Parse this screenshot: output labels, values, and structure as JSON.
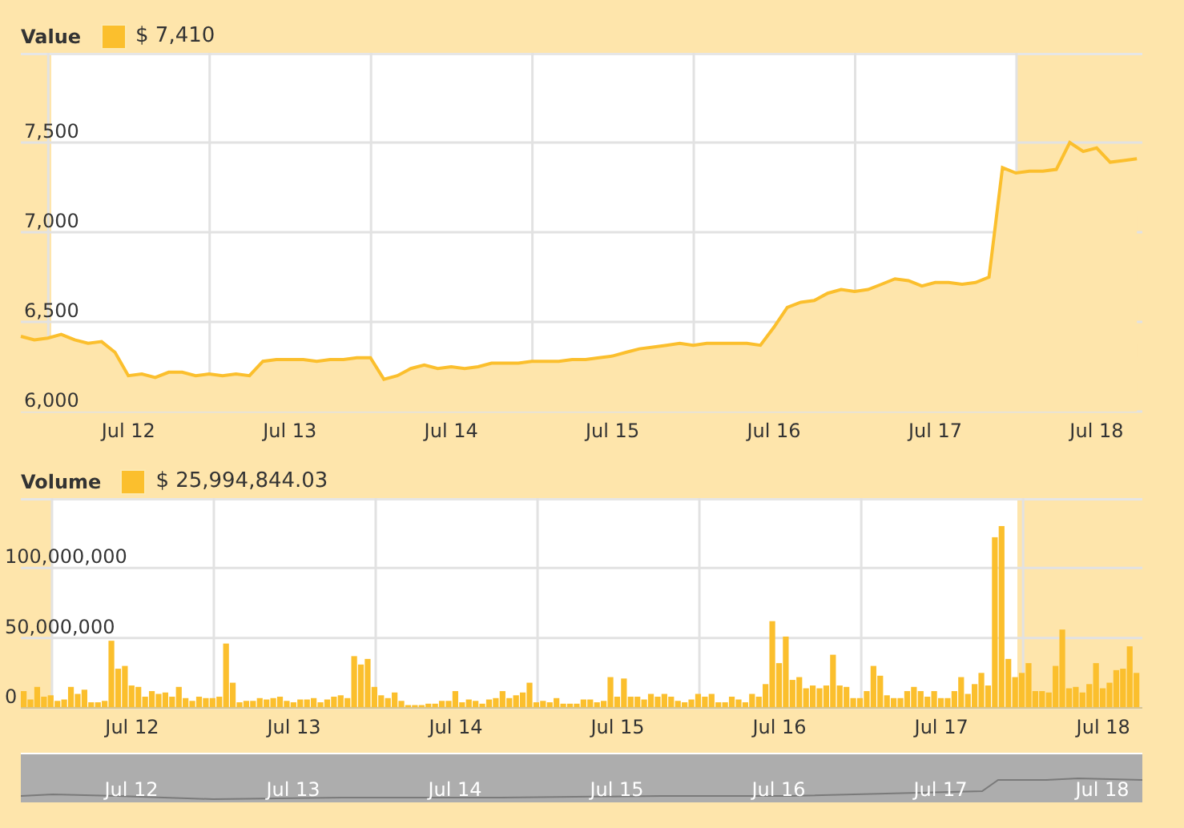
{
  "value_chart": {
    "reading": "$ 7,410",
    "chart_data": {
      "type": "area",
      "grid": true,
      "ylim": [
        6000,
        8000
      ],
      "categories": [
        null,
        null,
        null,
        null,
        null,
        null,
        null,
        null,
        "Jul 12",
        null,
        null,
        null,
        null,
        null,
        null,
        null,
        null,
        null,
        null,
        null,
        "Jul 13",
        null,
        null,
        null,
        null,
        null,
        null,
        null,
        null,
        null,
        null,
        null,
        "Jul 14",
        null,
        null,
        null,
        null,
        null,
        null,
        null,
        null,
        null,
        null,
        null,
        "Jul 15",
        null,
        null,
        null,
        null,
        null,
        null,
        null,
        null,
        null,
        null,
        null,
        "Jul 16",
        null,
        null,
        null,
        null,
        null,
        null,
        null,
        null,
        null,
        null,
        null,
        "Jul 17",
        null,
        null,
        null,
        null,
        null,
        null,
        null,
        null,
        null,
        null,
        null,
        "Jul 18",
        null,
        null,
        null
      ],
      "yticks": [
        {
          "value": 6000,
          "label": "6,000"
        },
        {
          "value": 6500,
          "label": "6,500"
        },
        {
          "value": 7000,
          "label": "7,000"
        },
        {
          "value": 7500,
          "label": "7,500"
        }
      ],
      "series": [
        {
          "name": "Value",
          "color": "#fbbf2d",
          "values": [
            6420,
            6400,
            6410,
            6430,
            6400,
            6380,
            6390,
            6330,
            6200,
            6210,
            6190,
            6220,
            6220,
            6200,
            6210,
            6200,
            6210,
            6200,
            6280,
            6290,
            6290,
            6290,
            6280,
            6290,
            6290,
            6300,
            6300,
            6180,
            6200,
            6240,
            6260,
            6240,
            6250,
            6240,
            6250,
            6270,
            6270,
            6270,
            6280,
            6280,
            6280,
            6290,
            6290,
            6300,
            6310,
            6330,
            6350,
            6360,
            6370,
            6380,
            6370,
            6380,
            6380,
            6380,
            6380,
            6370,
            6470,
            6580,
            6610,
            6620,
            6660,
            6680,
            6670,
            6680,
            6710,
            6740,
            6730,
            6700,
            6720,
            6720,
            6710,
            6720,
            6750,
            7360,
            7330,
            7340,
            7340,
            7350,
            7500,
            7450,
            7470,
            7390,
            7400,
            7410
          ]
        }
      ]
    }
  },
  "volume_chart": {
    "reading": "$ 25,994,844.03",
    "chart_data": {
      "type": "bar",
      "grid": true,
      "ylim": [
        0,
        150000000
      ],
      "categories": [
        null,
        null,
        null,
        null,
        null,
        null,
        null,
        null,
        null,
        null,
        null,
        null,
        null,
        null,
        null,
        null,
        "Jul 12",
        null,
        null,
        null,
        null,
        null,
        null,
        null,
        null,
        null,
        null,
        null,
        null,
        null,
        null,
        null,
        null,
        null,
        null,
        null,
        null,
        null,
        null,
        null,
        "Jul 13",
        null,
        null,
        null,
        null,
        null,
        null,
        null,
        null,
        null,
        null,
        null,
        null,
        null,
        null,
        null,
        null,
        null,
        null,
        null,
        null,
        null,
        null,
        null,
        "Jul 14",
        null,
        null,
        null,
        null,
        null,
        null,
        null,
        null,
        null,
        null,
        null,
        null,
        null,
        null,
        null,
        null,
        null,
        null,
        null,
        null,
        null,
        null,
        null,
        "Jul 15",
        null,
        null,
        null,
        null,
        null,
        null,
        null,
        null,
        null,
        null,
        null,
        null,
        null,
        null,
        null,
        null,
        null,
        null,
        null,
        null,
        null,
        null,
        null,
        "Jul 16",
        null,
        null,
        null,
        null,
        null,
        null,
        null,
        null,
        null,
        null,
        null,
        null,
        null,
        null,
        null,
        null,
        null,
        null,
        null,
        null,
        null,
        null,
        null,
        "Jul 17",
        null,
        null,
        null,
        null,
        null,
        null,
        null,
        null,
        null,
        null,
        null,
        null,
        null,
        null,
        null,
        null,
        null,
        null,
        null,
        null,
        null,
        null,
        null,
        "Jul 18",
        null,
        null,
        null,
        null,
        null
      ],
      "yticks": [
        {
          "value": 0,
          "label": "0"
        },
        {
          "value": 50000000,
          "label": "50,000,000"
        },
        {
          "value": 100000000,
          "label": "100,000,000"
        }
      ],
      "series": [
        {
          "name": "Volume",
          "color": "#fbbf2d",
          "values": [
            12000000,
            6000000,
            15000000,
            8000000,
            9000000,
            5000000,
            6000000,
            15000000,
            10000000,
            13000000,
            4000000,
            4000000,
            5000000,
            48000000,
            28000000,
            30000000,
            16000000,
            15000000,
            8000000,
            12000000,
            10000000,
            11000000,
            8000000,
            15000000,
            7000000,
            5000000,
            8000000,
            7000000,
            7000000,
            8000000,
            46000000,
            18000000,
            4000000,
            5000000,
            5000000,
            7000000,
            6000000,
            7000000,
            8000000,
            5000000,
            4000000,
            6000000,
            6000000,
            7000000,
            4000000,
            6000000,
            8000000,
            9000000,
            7000000,
            37000000,
            31000000,
            35000000,
            15000000,
            9000000,
            7000000,
            11000000,
            5000000,
            2000000,
            2000000,
            2000000,
            3000000,
            3000000,
            5000000,
            5000000,
            12000000,
            4000000,
            6000000,
            5000000,
            3000000,
            6000000,
            7000000,
            12000000,
            7000000,
            9000000,
            11000000,
            18000000,
            4000000,
            5000000,
            4000000,
            7000000,
            3000000,
            3000000,
            3000000,
            6000000,
            6000000,
            4000000,
            5000000,
            22000000,
            8000000,
            21000000,
            8000000,
            8000000,
            6000000,
            10000000,
            8000000,
            10000000,
            8000000,
            5000000,
            4000000,
            6000000,
            10000000,
            8000000,
            10000000,
            4000000,
            4000000,
            8000000,
            6000000,
            4000000,
            10000000,
            8000000,
            17000000,
            62000000,
            32000000,
            51000000,
            20000000,
            22000000,
            14000000,
            16000000,
            14000000,
            16000000,
            38000000,
            16000000,
            15000000,
            7000000,
            7000000,
            12000000,
            30000000,
            23000000,
            9000000,
            7000000,
            7000000,
            12000000,
            15000000,
            12000000,
            8000000,
            12000000,
            7000000,
            7000000,
            12000000,
            22000000,
            10000000,
            17000000,
            25000000,
            16000000,
            122000000,
            130000000,
            35000000,
            22000000,
            25000000,
            32000000,
            12000000,
            12000000,
            11000000,
            30000000,
            56000000,
            14000000,
            15000000,
            11000000,
            17000000,
            32000000,
            14000000,
            18000000,
            27000000,
            28000000,
            44000000,
            25000000
          ]
        }
      ]
    }
  },
  "navigator": {
    "labels": [
      "Jul 12",
      "Jul 13",
      "Jul 14",
      "Jul 15",
      "Jul 16",
      "Jul 17",
      "Jul 18"
    ]
  }
}
